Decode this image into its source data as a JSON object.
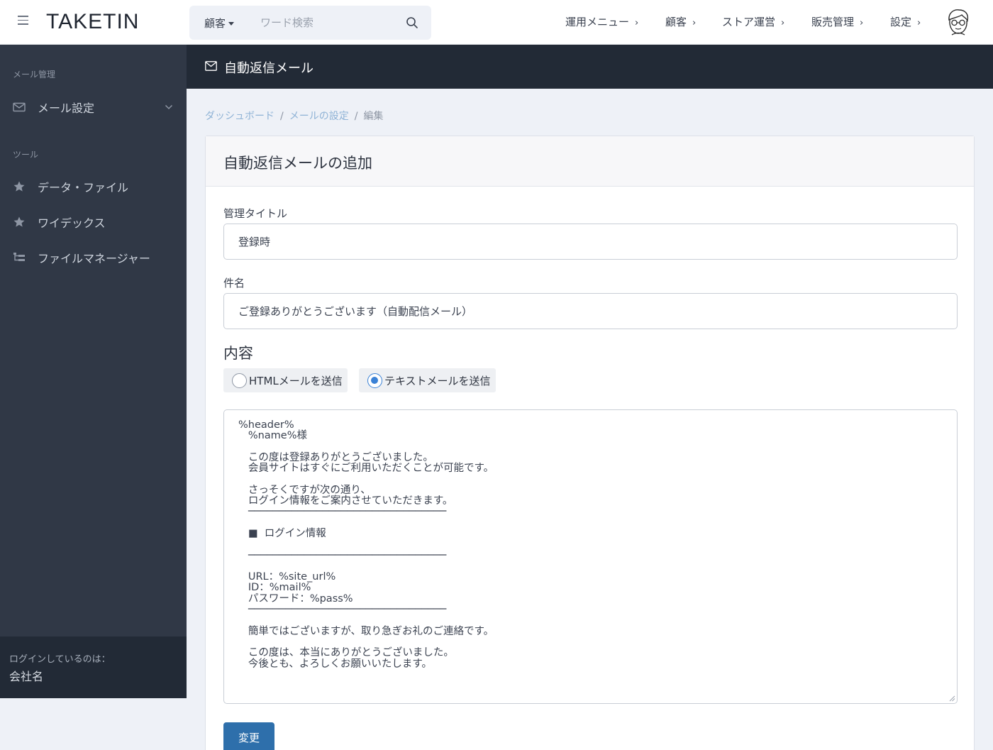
{
  "header": {
    "logo": "TAKETIN",
    "search": {
      "scope": "顧客",
      "placeholder": "ワード検索"
    },
    "nav": [
      "運用メニュー",
      "顧客",
      "ストア運営",
      "販売管理",
      "設定"
    ]
  },
  "sidebar": {
    "sections": [
      {
        "title": "メール管理",
        "items": [
          {
            "label": "メール設定",
            "icon": "mail-icon"
          }
        ]
      },
      {
        "title": "ツール",
        "items": [
          {
            "label": "データ・ファイル",
            "icon": "star-icon"
          },
          {
            "label": "ワイデックス",
            "icon": "star-icon"
          },
          {
            "label": "ファイルマネージャー",
            "icon": "sitemap-icon"
          }
        ]
      }
    ],
    "footer": {
      "label": "ログインしているのは：",
      "company": "会社名"
    }
  },
  "page": {
    "title": "自動返信メール",
    "breadcrumb": {
      "items": [
        "ダッシュボード",
        "メールの設定"
      ],
      "current": "編集"
    }
  },
  "form": {
    "card_title": "自動返信メールの追加",
    "admin_title": {
      "label": "管理タイトル",
      "value": "登録時"
    },
    "subject": {
      "label": "件名",
      "value": "ご登録ありがとうございます（自動配信メール）"
    },
    "content": {
      "title": "内容",
      "options": [
        "HTMLメールを送信",
        "テキストメールを送信"
      ],
      "selected": "テキストメールを送信",
      "body": "%header%\n   %name%様\n\n   この度は登録ありがとうございました。\n   会員サイトはすぐにご利用いただくことが可能です。\n\n   さっそくですが次の通り、\n   ログイン情報をご案内させていただきます。\n   ────────────────────────────────\n\n   ■  ログイン情報\n\n   ────────────────────────────────\n\n   URL：%site_url%\n   ID：%mail%\n   パスワード：%pass%\n   ────────────────────────────────\n\n   簡単ではございますが、取り急ぎお礼のご連絡です。\n\n   この度は、本当にありがとうございました。\n   今後とも、よろしくお願いいたします。"
    },
    "submit": "変更"
  },
  "colors": {
    "accent": "#2e6fab",
    "sidebar": "#303846",
    "header_dark": "#222a36",
    "radio_checked": "#3b82d6"
  }
}
